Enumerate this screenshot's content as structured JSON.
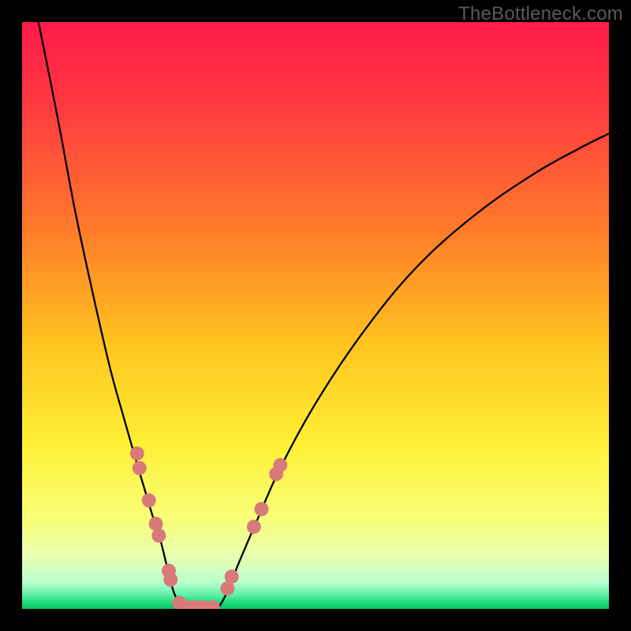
{
  "watermark": "TheBottleneck.com",
  "chart_data": {
    "type": "line",
    "title": "",
    "xlabel": "",
    "ylabel": "",
    "xlim": [
      0,
      1
    ],
    "ylim": [
      0,
      100
    ],
    "gradient_stops": [
      {
        "offset": 0.0,
        "color": "#ff1a4a"
      },
      {
        "offset": 0.15,
        "color": "#ff3b3f"
      },
      {
        "offset": 0.35,
        "color": "#ff7a2a"
      },
      {
        "offset": 0.55,
        "color": "#ffc41f"
      },
      {
        "offset": 0.72,
        "color": "#fff036"
      },
      {
        "offset": 0.85,
        "color": "#f8ff7a"
      },
      {
        "offset": 0.91,
        "color": "#e8ffb0"
      },
      {
        "offset": 0.955,
        "color": "#b8ffcf"
      },
      {
        "offset": 0.975,
        "color": "#63f0a8"
      },
      {
        "offset": 0.99,
        "color": "#18d977"
      },
      {
        "offset": 1.0,
        "color": "#0cc268"
      }
    ],
    "series": [
      {
        "name": "left-curve",
        "x": [
          0.028,
          0.06,
          0.09,
          0.12,
          0.15,
          0.175,
          0.195,
          0.21,
          0.225,
          0.235,
          0.245,
          0.252,
          0.262,
          0.275
        ],
        "y": [
          100,
          84,
          68,
          54,
          41,
          32,
          25,
          20,
          15,
          12,
          8,
          5,
          2,
          0.2
        ]
      },
      {
        "name": "right-curve",
        "x": [
          0.335,
          0.35,
          0.37,
          0.4,
          0.44,
          0.5,
          0.58,
          0.67,
          0.77,
          0.87,
          0.95,
          1.0
        ],
        "y": [
          0.2,
          3,
          8,
          15,
          24,
          35,
          47,
          58,
          67,
          74,
          78.5,
          81
        ]
      }
    ],
    "markers": {
      "name": "data-points",
      "color": "#d97a7a",
      "radius_px": 9,
      "points": [
        {
          "x": 0.196,
          "y": 26.5
        },
        {
          "x": 0.2,
          "y": 24.0
        },
        {
          "x": 0.216,
          "y": 18.5
        },
        {
          "x": 0.228,
          "y": 14.5
        },
        {
          "x": 0.233,
          "y": 12.5
        },
        {
          "x": 0.25,
          "y": 6.5
        },
        {
          "x": 0.253,
          "y": 5.0
        },
        {
          "x": 0.268,
          "y": 1.0
        },
        {
          "x": 0.278,
          "y": 0.3
        },
        {
          "x": 0.293,
          "y": 0.3
        },
        {
          "x": 0.308,
          "y": 0.3
        },
        {
          "x": 0.325,
          "y": 0.3
        },
        {
          "x": 0.35,
          "y": 3.5
        },
        {
          "x": 0.357,
          "y": 5.5
        },
        {
          "x": 0.395,
          "y": 14.0
        },
        {
          "x": 0.408,
          "y": 17.0
        },
        {
          "x": 0.433,
          "y": 23.0
        },
        {
          "x": 0.44,
          "y": 24.5
        }
      ]
    }
  }
}
